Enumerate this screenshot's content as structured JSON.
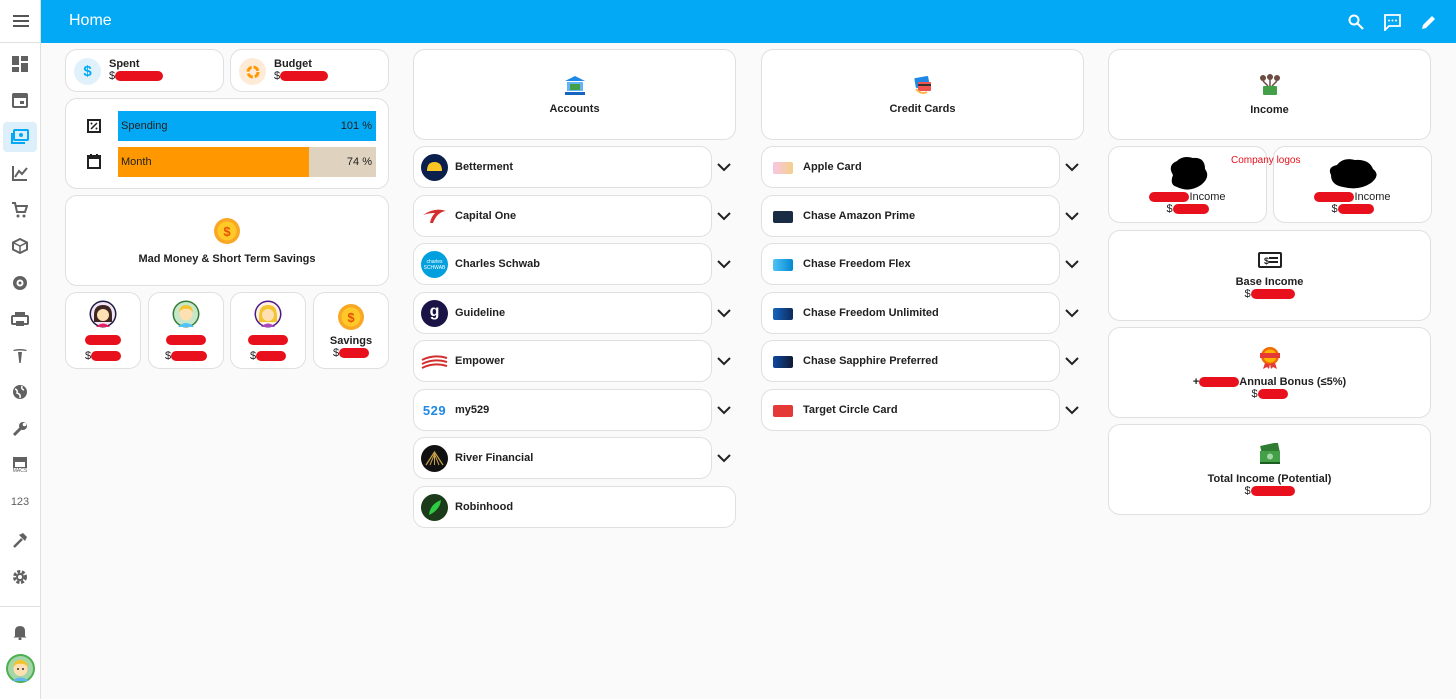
{
  "header": {
    "title": "Home"
  },
  "sidebar": {
    "items": [
      "menu-icon",
      "dashboard-icon",
      "calendar-icon",
      "money-icon",
      "chart-icon",
      "cart-icon",
      "package-icon",
      "robot-icon",
      "printer-icon",
      "tesla-icon",
      "globe-icon",
      "wrench-icon",
      "store-icon",
      "numeric-icon",
      "hammer-icon",
      "settings-icon",
      "bell-icon",
      "avatar"
    ],
    "store_label": "MACS",
    "numeric_label": "123"
  },
  "summary": {
    "spent_label": "Spent",
    "spent_prefix": "$",
    "budget_label": "Budget",
    "budget_prefix": "$"
  },
  "progress": {
    "spending_label": "Spending",
    "spending_value": "101 %",
    "spending_fraction": 1.0,
    "month_label": "Month",
    "month_value": "74 %",
    "month_fraction": 0.74
  },
  "savings_card": {
    "title": "Mad Money & Short Term Savings"
  },
  "people": [
    {
      "prefix": "$"
    },
    {
      "prefix": "$"
    },
    {
      "prefix": "$"
    },
    {
      "name": "Savings",
      "prefix": "$"
    }
  ],
  "accounts": {
    "title": "Accounts",
    "items": [
      "Betterment",
      "Capital One",
      "Charles Schwab",
      "Guideline",
      "Empower",
      "my529",
      "River Financial",
      "Robinhood"
    ],
    "schwab_logo_text": "charles SCHWAB",
    "my529_logo_text": "529"
  },
  "credit_cards": {
    "title": "Credit Cards",
    "items": [
      "Apple Card",
      "Chase Amazon Prime",
      "Chase Freedom Flex",
      "Chase Freedom Unlimited",
      "Chase Sapphire Preferred",
      "Target Circle Card"
    ]
  },
  "income": {
    "title": "Income",
    "annotation": "Company logos",
    "company1_suffix": "Income",
    "company1_prefix": "$",
    "company2_suffix": "Income",
    "company2_prefix": "$",
    "base_title": "Base Income",
    "base_prefix": "$",
    "bonus_lead": "+",
    "bonus_title": "Annual Bonus (≤5%)",
    "bonus_prefix": "$",
    "total_title": "Total Income (Potential)",
    "total_prefix": "$"
  },
  "colors": {
    "accent": "#03a9f4",
    "spending_bar": "#03a9f4",
    "month_bar": "#ff9800",
    "month_track": "#dfd3bf",
    "redaction": "#e8101c",
    "annotation": "#e8101c"
  }
}
